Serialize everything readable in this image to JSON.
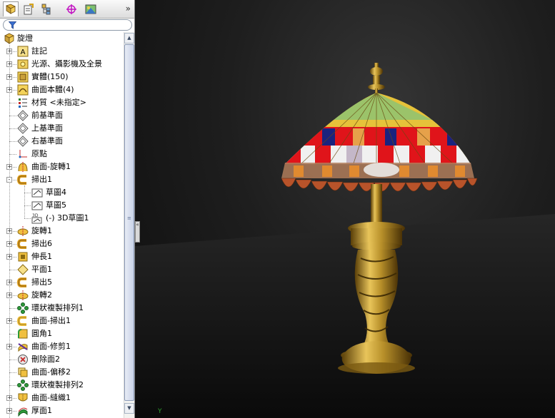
{
  "tabs": {
    "items": [
      {
        "name": "feature-manager-tab",
        "icon": "feature-tree-icon"
      },
      {
        "name": "property-manager-tab",
        "icon": "property-icon"
      },
      {
        "name": "configuration-manager-tab",
        "icon": "configuration-icon"
      },
      {
        "name": "dimxpert-manager-tab",
        "icon": "dimxpert-icon"
      },
      {
        "name": "display-manager-tab",
        "icon": "display-icon"
      }
    ],
    "more_label": "»"
  },
  "filter": {
    "icon": "filter-icon"
  },
  "tree": {
    "root": "旋燈",
    "items": [
      {
        "label": "註記",
        "icon": "annotation-icon",
        "expand": "+"
      },
      {
        "label": "光源、攝影機及全景",
        "icon": "lights-camera-icon",
        "expand": "+"
      },
      {
        "label": "實體(150)",
        "icon": "solid-bodies-icon",
        "expand": "+"
      },
      {
        "label": "曲面本體(4)",
        "icon": "surface-bodies-icon",
        "expand": "+"
      },
      {
        "label": "材質 <未指定>",
        "icon": "material-icon",
        "expand": ""
      },
      {
        "label": "前基準面",
        "icon": "plane-icon",
        "expand": ""
      },
      {
        "label": "上基準面",
        "icon": "plane-icon",
        "expand": ""
      },
      {
        "label": "右基準面",
        "icon": "plane-icon",
        "expand": ""
      },
      {
        "label": "原點",
        "icon": "origin-icon",
        "expand": ""
      },
      {
        "label": "曲面-旋轉1",
        "icon": "surface-revolve-icon",
        "expand": "+"
      },
      {
        "label": "掃出1",
        "icon": "sweep-icon",
        "expand": "-"
      },
      {
        "label": "草圖4",
        "icon": "sketch-icon",
        "expand": "",
        "child": true
      },
      {
        "label": "草圖5",
        "icon": "sketch-icon",
        "expand": "",
        "child": true
      },
      {
        "label": "(-) 3D草圖1",
        "icon": "3d-sketch-icon",
        "expand": "",
        "child": true
      },
      {
        "label": "旋轉1",
        "icon": "revolve-icon",
        "expand": "+"
      },
      {
        "label": "掃出6",
        "icon": "sweep-icon",
        "expand": "+"
      },
      {
        "label": "伸長1",
        "icon": "extrude-icon",
        "expand": "+"
      },
      {
        "label": "平面1",
        "icon": "plane-feature-icon",
        "expand": ""
      },
      {
        "label": "掃出5",
        "icon": "sweep-icon",
        "expand": "+"
      },
      {
        "label": "旋轉2",
        "icon": "revolve-icon",
        "expand": "+"
      },
      {
        "label": "環狀複製排列1",
        "icon": "circular-pattern-icon",
        "expand": ""
      },
      {
        "label": "曲面-掃出1",
        "icon": "surface-sweep-icon",
        "expand": "+"
      },
      {
        "label": "圓角1",
        "icon": "fillet-icon",
        "expand": ""
      },
      {
        "label": "曲面-修剪1",
        "icon": "surface-trim-icon",
        "expand": "+"
      },
      {
        "label": "刪除面2",
        "icon": "delete-face-icon",
        "expand": ""
      },
      {
        "label": "曲面-偏移2",
        "icon": "surface-offset-icon",
        "expand": ""
      },
      {
        "label": "環狀複製排列2",
        "icon": "circular-pattern-icon",
        "expand": ""
      },
      {
        "label": "曲面-縫織1",
        "icon": "surface-knit-icon",
        "expand": "+"
      },
      {
        "label": "厚面1",
        "icon": "thicken-icon",
        "expand": "+"
      }
    ]
  },
  "viewport": {
    "model": "tiffany-table-lamp-model",
    "colors": {
      "shade_red": "#e0141a",
      "shade_blue": "#1a237e",
      "shade_yellow": "#e6c23a",
      "shade_green": "#9bc36a",
      "fringe_orange": "#c0552a",
      "brass": "#b8902a"
    }
  },
  "collapse_handle": "«",
  "triad_label": "Y"
}
